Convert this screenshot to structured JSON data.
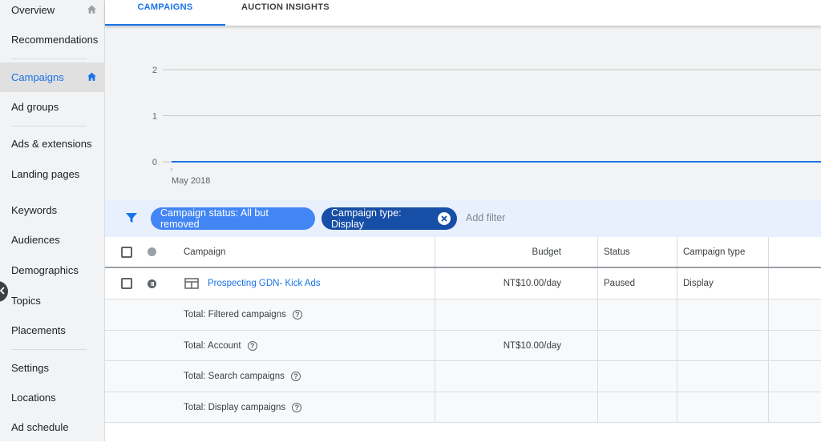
{
  "sidebar": {
    "items": [
      {
        "label": "Overview"
      },
      {
        "label": "Recommendations"
      },
      {
        "label": "Campaigns"
      },
      {
        "label": "Ad groups"
      },
      {
        "label": "Ads & extensions"
      },
      {
        "label": "Landing pages"
      },
      {
        "label": "Keywords"
      },
      {
        "label": "Audiences"
      },
      {
        "label": "Demographics"
      },
      {
        "label": "Topics"
      },
      {
        "label": "Placements"
      },
      {
        "label": "Settings"
      },
      {
        "label": "Locations"
      },
      {
        "label": "Ad schedule"
      }
    ],
    "active_index": 2
  },
  "tabs": [
    {
      "label": "CAMPAIGNS"
    },
    {
      "label": "AUCTION INSIGHTS"
    }
  ],
  "chart_data": {
    "type": "line",
    "x_tick_labels": [
      "May 2018"
    ],
    "y_ticks": [
      0,
      1,
      2
    ],
    "ylim": [
      0,
      2
    ],
    "series": [
      {
        "values": [
          0,
          0
        ]
      }
    ],
    "grid": true,
    "line_color": "#1a73e8"
  },
  "filters": {
    "chips": [
      {
        "label": "Campaign status: All but removed"
      },
      {
        "label": "Campaign type: Display"
      }
    ],
    "add_filter": "Add filter"
  },
  "table": {
    "columns": [
      "Campaign",
      "Budget",
      "Status",
      "Campaign type"
    ],
    "rows": [
      {
        "campaign": "Prospecting GDN- Kick Ads",
        "budget": "NT$10.00/day",
        "status": "Paused",
        "type": "Display"
      }
    ],
    "totals": [
      {
        "label": "Total: Filtered campaigns",
        "budget": ""
      },
      {
        "label": "Total: Account",
        "budget": "NT$10.00/day"
      },
      {
        "label": "Total: Search campaigns",
        "budget": ""
      },
      {
        "label": "Total: Display campaigns",
        "budget": ""
      }
    ]
  },
  "icons": {
    "home": "home-icon",
    "filter": "filter-icon",
    "remove": "close-circle-icon",
    "help": "help-icon",
    "display_ad": "display-ad-icon"
  },
  "colors": {
    "accent": "#1a73e8",
    "chip_light": "#4285f4",
    "chip_dark": "#174ea6"
  }
}
